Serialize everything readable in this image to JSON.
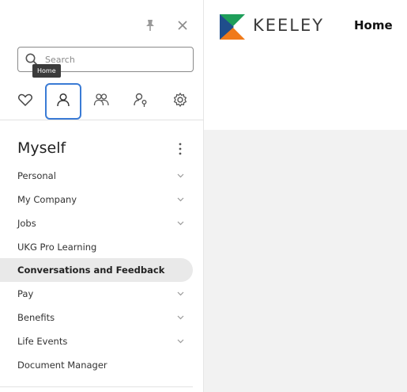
{
  "header": {
    "brand": "KEELEY",
    "page_link": "Home"
  },
  "search": {
    "placeholder": "Search"
  },
  "tooltip": {
    "text": "Home"
  },
  "tabs": [
    {
      "name": "favorites",
      "icon": "heart-icon"
    },
    {
      "name": "myself",
      "icon": "person-icon",
      "active": true
    },
    {
      "name": "my-team",
      "icon": "team-icon"
    },
    {
      "name": "administration",
      "icon": "admin-person-icon"
    },
    {
      "name": "settings",
      "icon": "gear-icon"
    }
  ],
  "menu": {
    "title": "Myself",
    "items": [
      {
        "label": "Personal",
        "expandable": true
      },
      {
        "label": "My Company",
        "expandable": true
      },
      {
        "label": "Jobs",
        "expandable": true
      },
      {
        "label": "UKG Pro Learning",
        "expandable": false
      },
      {
        "label": "Conversations and Feedback",
        "expandable": false,
        "active": true
      },
      {
        "label": "Pay",
        "expandable": true
      },
      {
        "label": "Benefits",
        "expandable": true
      },
      {
        "label": "Life Events",
        "expandable": true
      },
      {
        "label": "Document Manager",
        "expandable": false
      }
    ]
  },
  "colors": {
    "active_tab_border": "#3a7bd5",
    "active_item_bg": "#e9e9e9",
    "logo_green": "#1e9e5a",
    "logo_blue": "#1f4e8c",
    "logo_orange": "#f07a1a"
  }
}
